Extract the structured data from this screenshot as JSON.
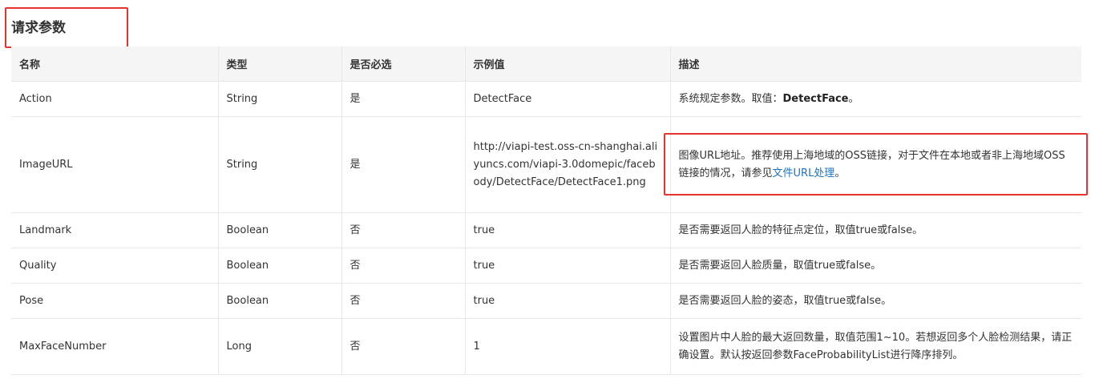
{
  "section": {
    "title": "请求参数"
  },
  "table": {
    "headers": [
      "名称",
      "类型",
      "是否必选",
      "示例值",
      "描述"
    ],
    "rows": [
      {
        "name": "Action",
        "type": "String",
        "required": "是",
        "example": "DetectFace",
        "desc_prefix": "系统规定参数。取值：",
        "desc_strong": "DetectFace",
        "desc_suffix": "。"
      },
      {
        "name": "ImageURL",
        "type": "String",
        "required": "是",
        "example": "http://viapi-test.oss-cn-shanghai.aliyuncs.com/viapi-3.0domepic/facebody/DetectFace/DetectFace1.png",
        "desc_prefix": "图像URL地址。推荐使用上海地域的OSS链接，对于文件在本地或者非上海地域OSS链接的情况，请参见",
        "desc_link": "文件URL处理",
        "desc_suffix": "。"
      },
      {
        "name": "Landmark",
        "type": "Boolean",
        "required": "否",
        "example": "true",
        "desc": "是否需要返回人脸的特征点定位，取值true或false。"
      },
      {
        "name": "Quality",
        "type": "Boolean",
        "required": "否",
        "example": "true",
        "desc": "是否需要返回人脸质量，取值true或false。"
      },
      {
        "name": "Pose",
        "type": "Boolean",
        "required": "否",
        "example": "true",
        "desc": "是否需要返回人脸的姿态，取值true或false。"
      },
      {
        "name": "MaxFaceNumber",
        "type": "Long",
        "required": "否",
        "example": "1",
        "desc": "设置图片中人脸的最大返回数量，取值范围1~10。若想返回多个人脸检测结果，请正确设置。默认按返回参数FaceProbabilityList进行降序排列。"
      }
    ]
  },
  "colors": {
    "highlight_border": "#e8322e",
    "link": "#1a73c8",
    "header_bg": "#f5f5f5"
  }
}
